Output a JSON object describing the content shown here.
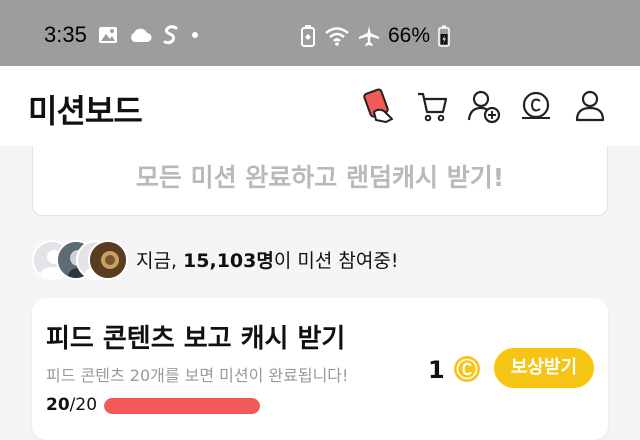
{
  "status_bar": {
    "time": "3:35",
    "battery_percent": "66%",
    "icons_left": [
      "photo-icon",
      "cloud-icon",
      "s-app-icon",
      "dot-icon"
    ],
    "icons_right": [
      "battery-saver-icon",
      "wifi-icon",
      "airplane-icon",
      "battery-icon"
    ]
  },
  "app_bar": {
    "title": "미션보드",
    "icons": [
      "card-hand-icon",
      "cart-icon",
      "add-friend-icon",
      "coin-history-icon",
      "profile-icon"
    ]
  },
  "banner": {
    "text": "모든 미션 완료하고 랜덤캐시 받기!"
  },
  "participation": {
    "prefix": "지금, ",
    "count": "15,103명",
    "suffix": "이 미션 참여중!"
  },
  "mission": {
    "title": "피드 콘텐츠 보고 캐시 받기",
    "description": "피드 콘텐츠 20개를 보면 미션이 완료됩니다!",
    "progress_current": "20",
    "progress_total": "/20",
    "progress_fraction": 1.0,
    "reward_amount": "1",
    "reward_button": "보상받기"
  },
  "colors": {
    "status_bar_bg": "#9d9d9d",
    "progress_fill": "#f25a5a",
    "reward_button_bg": "#f6c414",
    "coin": "#f5c518"
  }
}
